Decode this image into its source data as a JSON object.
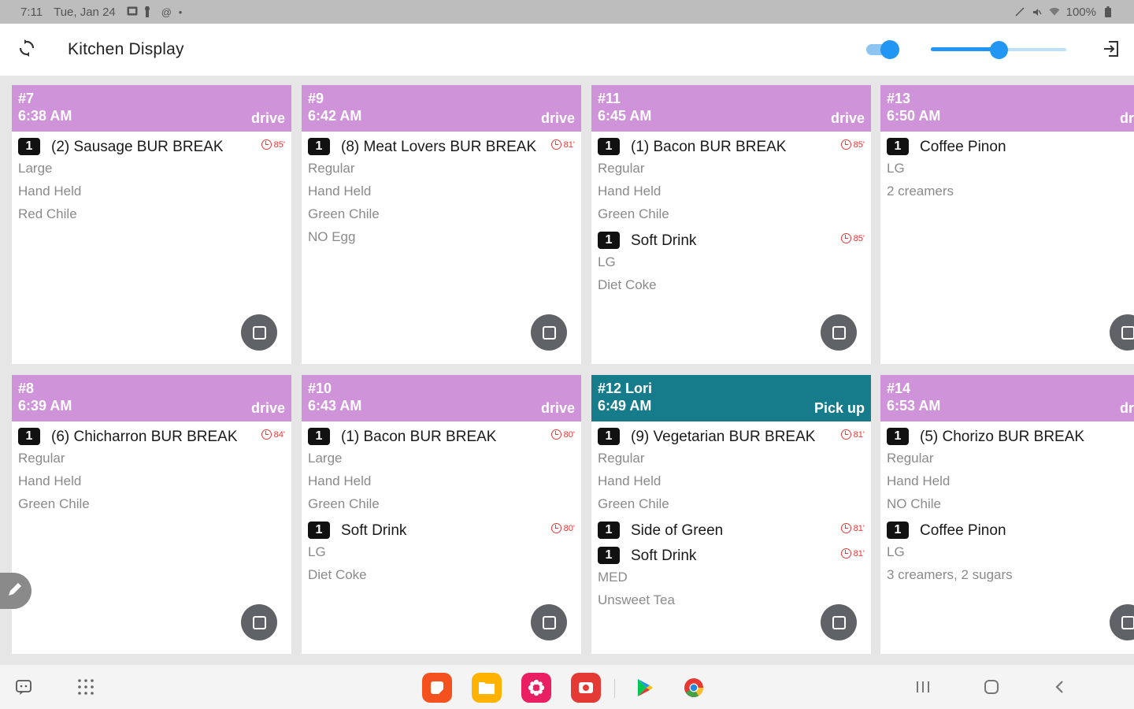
{
  "status_bar": {
    "time": "7:11",
    "date": "Tue, Jan 24",
    "battery": "100%"
  },
  "app_bar": {
    "title": "Kitchen Display",
    "toggle_on": true,
    "slider_level": 0.5
  },
  "colors": {
    "header_drive": "#ce93d8",
    "header_pickup": "#167b8a",
    "timer": "#e53935",
    "accent": "#2196f3"
  },
  "orders": [
    {
      "number": "#7",
      "time": "6:38 AM",
      "type": "drive",
      "style": "drive",
      "items": [
        {
          "qty": "1",
          "name": "(2) Sausage BUR BREAK",
          "timer": "85'",
          "mods": [
            "Large",
            "Hand Held",
            "Red Chile"
          ]
        }
      ]
    },
    {
      "number": "#9",
      "time": "6:42 AM",
      "type": "drive",
      "style": "drive",
      "items": [
        {
          "qty": "1",
          "name": "(8) Meat Lovers BUR BREAK",
          "timer": "81'",
          "mods": [
            "Regular",
            "Hand Held",
            "Green Chile",
            "NO Egg"
          ]
        }
      ]
    },
    {
      "number": "#11",
      "time": "6:45 AM",
      "type": "drive",
      "style": "drive",
      "items": [
        {
          "qty": "1",
          "name": "(1) Bacon BUR BREAK",
          "timer": "85'",
          "mods": [
            "Regular",
            "Hand Held",
            "Green Chile"
          ]
        },
        {
          "qty": "1",
          "name": "Soft Drink",
          "timer": "85'",
          "mods": [
            "LG",
            "Diet Coke"
          ]
        }
      ]
    },
    {
      "number": "#13",
      "time": "6:50 AM",
      "type": "drive",
      "style": "drive",
      "items": [
        {
          "qty": "1",
          "name": "Coffee Pinon",
          "timer": "",
          "mods": [
            "LG",
            "2 creamers"
          ]
        }
      ]
    },
    {
      "number": "#8",
      "time": "6:39 AM",
      "type": "drive",
      "style": "drive",
      "items": [
        {
          "qty": "1",
          "name": "(6) Chicharron BUR BREAK",
          "timer": "84'",
          "mods": [
            "Regular",
            "Hand Held",
            "Green Chile"
          ]
        }
      ]
    },
    {
      "number": "#10",
      "time": "6:43 AM",
      "type": "drive",
      "style": "drive",
      "items": [
        {
          "qty": "1",
          "name": "(1) Bacon BUR BREAK",
          "timer": "80'",
          "mods": [
            "Large",
            "Hand Held",
            "Green Chile"
          ]
        },
        {
          "qty": "1",
          "name": "Soft Drink",
          "timer": "80'",
          "mods": [
            "LG",
            "Diet Coke"
          ]
        }
      ]
    },
    {
      "number": "#12 Lori",
      "time": "6:49 AM",
      "type": "Pick up",
      "style": "pickup",
      "items": [
        {
          "qty": "1",
          "name": "(9) Vegetarian BUR BREAK",
          "timer": "81'",
          "mods": [
            "Regular",
            "Hand Held",
            "Green Chile"
          ]
        },
        {
          "qty": "1",
          "name": "Side of Green",
          "timer": "81'",
          "mods": []
        },
        {
          "qty": "1",
          "name": "Soft Drink",
          "timer": "81'",
          "mods": [
            "MED",
            "Unsweet Tea"
          ]
        }
      ]
    },
    {
      "number": "#14",
      "time": "6:53 AM",
      "type": "drive",
      "style": "drive",
      "items": [
        {
          "qty": "1",
          "name": "(5) Chorizo BUR BREAK",
          "timer": "",
          "mods": [
            "Regular",
            "Hand Held",
            "NO Chile"
          ]
        },
        {
          "qty": "1",
          "name": "Coffee Pinon",
          "timer": "",
          "mods": [
            "LG",
            "3 creamers, 2 sugars"
          ]
        }
      ]
    }
  ]
}
